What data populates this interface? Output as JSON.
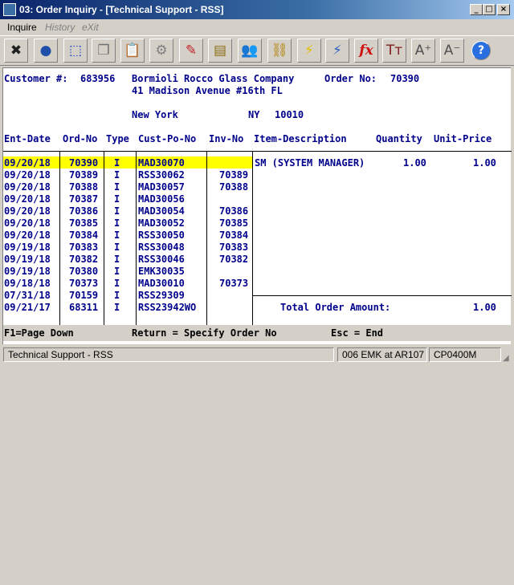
{
  "window": {
    "title": "03: Order Inquiry - [Technical Support - RSS]"
  },
  "window_buttons": {
    "minimize": "_",
    "maximize": "□",
    "close": "×"
  },
  "menu": [
    {
      "label": "Inquire",
      "enabled": true
    },
    {
      "label": "History",
      "enabled": false
    },
    {
      "label": "eXit",
      "enabled": false
    }
  ],
  "toolbar": [
    {
      "icon": "close-x-icon",
      "glyph": "✖",
      "color": "#202020"
    },
    {
      "icon": "globe-icon",
      "glyph": "●",
      "color": "#1f4fa8"
    },
    {
      "icon": "select-box-icon",
      "glyph": "⬚",
      "color": "#1a3dc0"
    },
    {
      "icon": "copy-icon",
      "glyph": "❐",
      "color": "#707070"
    },
    {
      "icon": "paste-icon",
      "glyph": "📋",
      "color": "#707070"
    },
    {
      "icon": "gear-icon",
      "glyph": "⚙",
      "color": "#808080"
    },
    {
      "icon": "edit-pencil-icon",
      "glyph": "✎",
      "color": "#c0202a"
    },
    {
      "icon": "notepad-icon",
      "glyph": "▤",
      "color": "#8a6a10"
    },
    {
      "icon": "users-icon",
      "glyph": "👥",
      "color": "#2a7a3a"
    },
    {
      "icon": "chain-link-icon",
      "glyph": "⛓",
      "color": "#b08000"
    },
    {
      "icon": "lightning-icon",
      "glyph": "⚡",
      "color": "#e0c000"
    },
    {
      "icon": "window-lightning-icon",
      "glyph": "⚡",
      "color": "#3060c0"
    },
    {
      "icon": "function-icon",
      "glyph": "fx",
      "color": "#d01010"
    },
    {
      "icon": "font-size-icon",
      "glyph": "Tт",
      "color": "#802020"
    },
    {
      "icon": "font-grow-icon",
      "glyph": "A⁺",
      "color": "#505050"
    },
    {
      "icon": "font-shrink-icon",
      "glyph": "A⁻",
      "color": "#505050"
    },
    {
      "icon": "help-icon",
      "glyph": "?",
      "color": "#1a5fd0"
    }
  ],
  "header": {
    "customer_label": "Customer #:",
    "customer_number": "683956",
    "customer_name": "Bormioli Rocco Glass Company",
    "order_label": "Order No:",
    "order_number": "70390",
    "address": "41 Madison Avenue #16th FL",
    "city": "New York",
    "state": "NY",
    "zip": "10010"
  },
  "columns": {
    "ent_date": "Ent-Date",
    "ord_no": "Ord-No",
    "type": "Type",
    "cust_po": "Cust-Po-No",
    "inv_no": "Inv-No",
    "item_desc": "Item-Description",
    "quantity": "Quantity",
    "unit_price": "Unit-Price"
  },
  "orders": [
    {
      "date": "09/20/18",
      "ord": "70390",
      "type": "I",
      "po": "MAD30070",
      "inv": "",
      "selected": true
    },
    {
      "date": "09/20/18",
      "ord": "70389",
      "type": "I",
      "po": "RSS30062",
      "inv": "70389"
    },
    {
      "date": "09/20/18",
      "ord": "70388",
      "type": "I",
      "po": "MAD30057",
      "inv": "70388"
    },
    {
      "date": "09/20/18",
      "ord": "70387",
      "type": "I",
      "po": "MAD30056",
      "inv": ""
    },
    {
      "date": "09/20/18",
      "ord": "70386",
      "type": "I",
      "po": "MAD30054",
      "inv": "70386"
    },
    {
      "date": "09/20/18",
      "ord": "70385",
      "type": "I",
      "po": "MAD30052",
      "inv": "70385"
    },
    {
      "date": "09/20/18",
      "ord": "70384",
      "type": "I",
      "po": "RSS30050",
      "inv": "70384"
    },
    {
      "date": "09/19/18",
      "ord": "70383",
      "type": "I",
      "po": "RSS30048",
      "inv": "70383"
    },
    {
      "date": "09/19/18",
      "ord": "70382",
      "type": "I",
      "po": "RSS30046",
      "inv": "70382"
    },
    {
      "date": "09/19/18",
      "ord": "70380",
      "type": "I",
      "po": "EMK30035",
      "inv": ""
    },
    {
      "date": "09/18/18",
      "ord": "70373",
      "type": "I",
      "po": "MAD30010",
      "inv": "70373"
    },
    {
      "date": "07/31/18",
      "ord": "70159",
      "type": "I",
      "po": "RSS29309",
      "inv": ""
    },
    {
      "date": "09/21/17",
      "ord": "68311",
      "type": "I",
      "po": "RSS23942WO",
      "inv": ""
    }
  ],
  "line_items": [
    {
      "desc": "SM (SYSTEM MANAGER)",
      "qty": "1.00",
      "price": "1.00"
    }
  ],
  "total": {
    "label": "Total Order Amount:",
    "value": "1.00"
  },
  "function_keys": {
    "f1": "F1=Page Down",
    "return": "Return = Specify Order No",
    "esc": "Esc = End"
  },
  "status": {
    "session": "Technical Support - RSS",
    "location": "006 EMK at AR107",
    "program": "CP0400M"
  },
  "colors": {
    "highlight": "#ffff00",
    "text": "#00008b"
  }
}
